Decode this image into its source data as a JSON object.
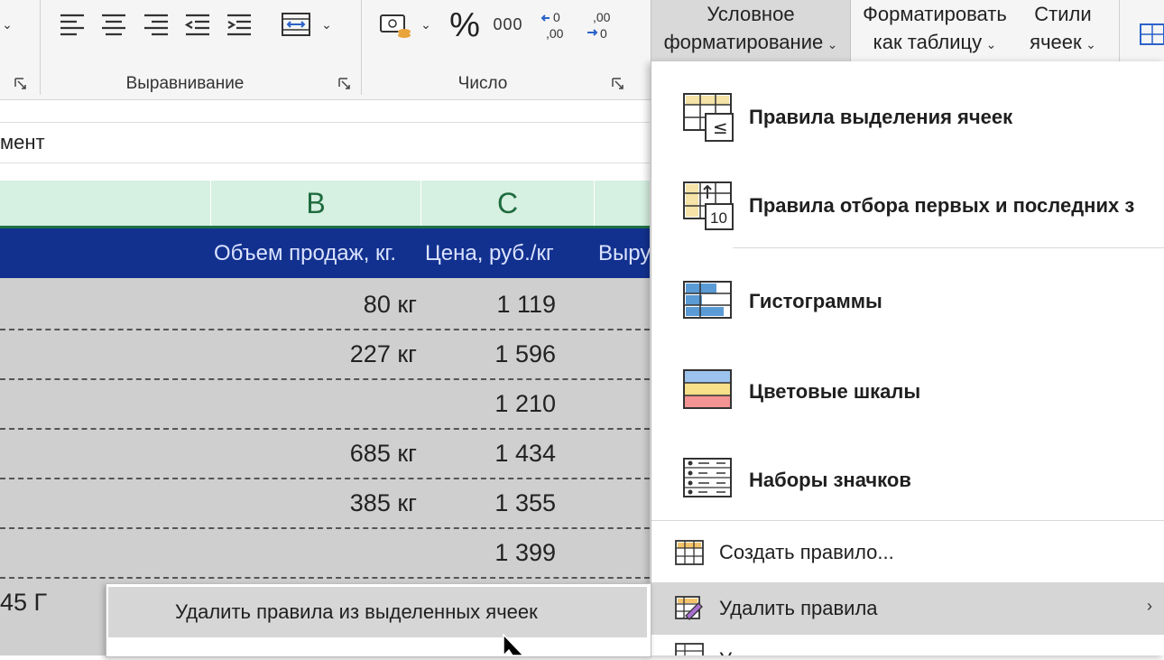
{
  "ribbon": {
    "alignment_group": {
      "label": "Выравнивание"
    },
    "number_group": {
      "label": "Число",
      "percent_symbol": "%",
      "thousands_symbol": "000",
      "increase_decimal": ",00",
      "decrease_decimal": ",00"
    },
    "conditional_formatting": {
      "line1": "Условное",
      "line2": "форматирование"
    },
    "format_as_table": {
      "line1": "Форматировать",
      "line2": "как таблицу"
    },
    "cell_styles": {
      "line1": "Стили",
      "line2": "ячеек"
    }
  },
  "formula_bar": {
    "text": "мент"
  },
  "columns": {
    "b": "B",
    "c": "C"
  },
  "table": {
    "headers": [
      "Объем продаж, кг.",
      "Цена, руб./кг",
      "Выру"
    ],
    "rows": [
      {
        "qty": "80 кг",
        "price": "1 119"
      },
      {
        "qty": "227 кг",
        "price": "1 596"
      },
      {
        "qty": "",
        "price": "1 210"
      },
      {
        "qty": "685 кг",
        "price": "1 434"
      },
      {
        "qty": "385 кг",
        "price": "1 355"
      },
      {
        "qty": "",
        "price": "1 399"
      }
    ],
    "partial_cell": "45 Г"
  },
  "cf_menu": {
    "items": [
      {
        "label": "Правила выделения ячеек",
        "icon": "highlight-cells-rules-icon"
      },
      {
        "label": "Правила отбора первых и последних з",
        "icon": "top-bottom-rules-icon"
      },
      {
        "label": "Гистограммы",
        "icon": "data-bars-icon"
      },
      {
        "label": "Цветовые шкалы",
        "icon": "color-scales-icon"
      },
      {
        "label": "Наборы значков",
        "icon": "icon-sets-icon"
      }
    ],
    "new_rule": "Создать правило...",
    "clear_rules": "Удалить правила",
    "manage_rules": "У"
  },
  "submenu": {
    "clear_selected": "Удалить правила из выделенных ячеек"
  },
  "colors": {
    "header_fill": "#12318f",
    "column_header": "#d6f0e1",
    "excel_green": "#1e7145",
    "menu_highlight": "#d6d6d6"
  }
}
